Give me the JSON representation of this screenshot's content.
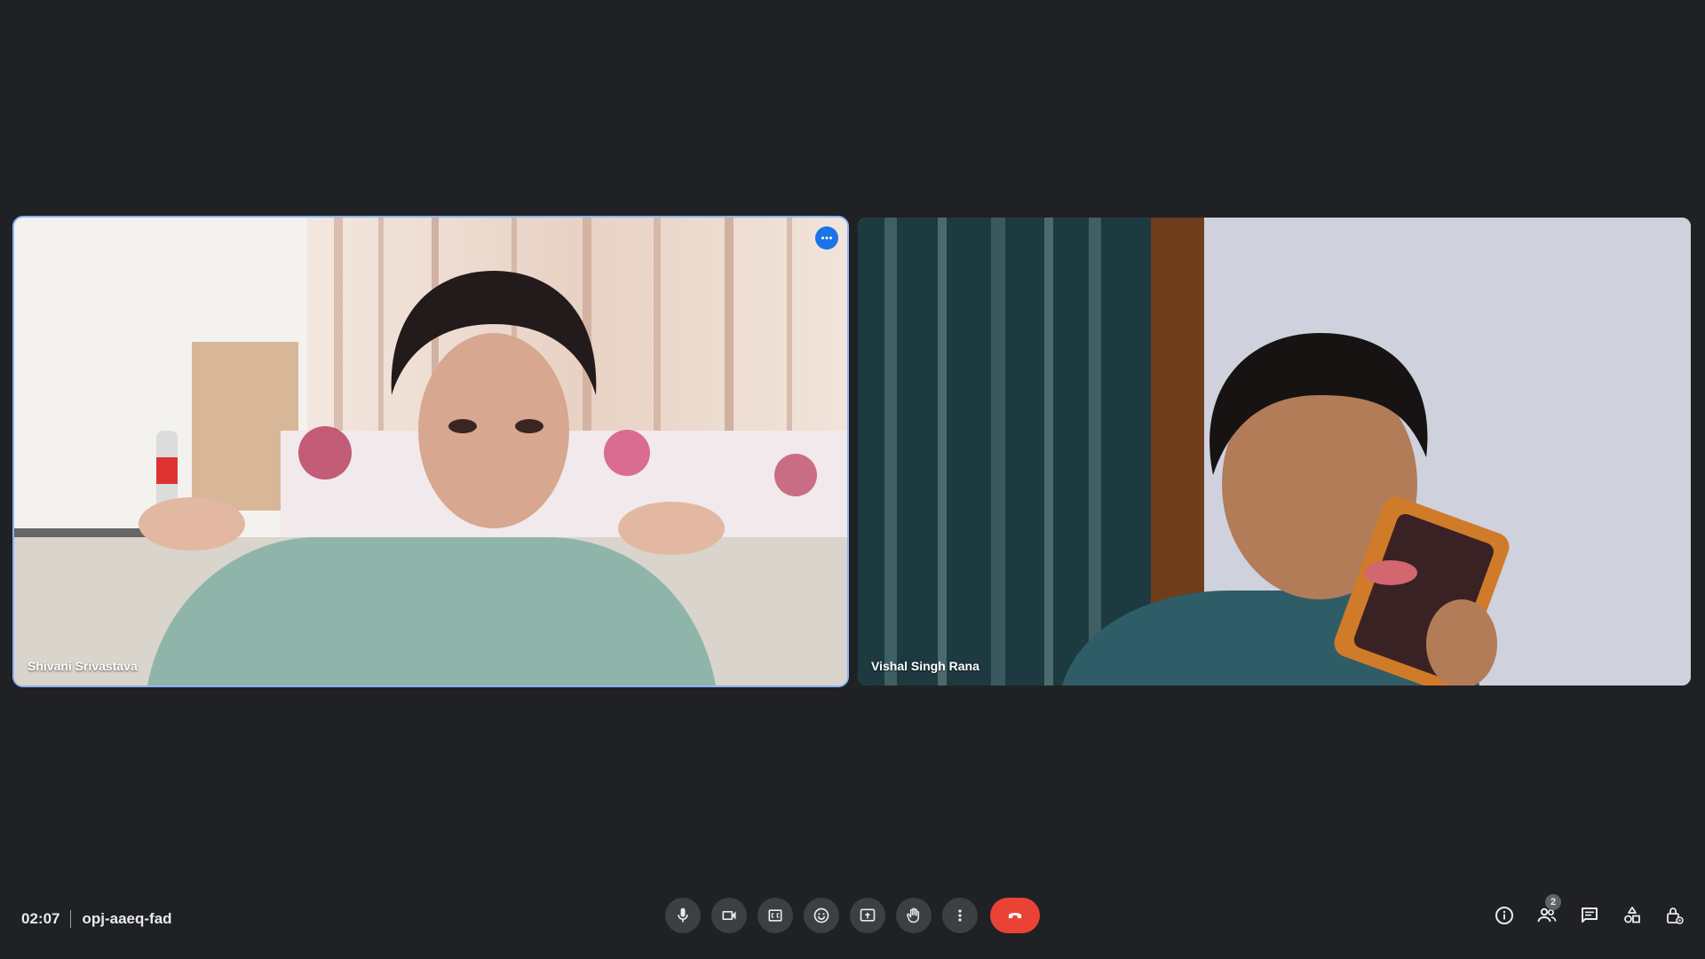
{
  "meeting": {
    "time": "02:07",
    "code": "opj-aaeq-fad"
  },
  "participants": [
    {
      "name": "Shivani Srivastava",
      "speaking": true
    },
    {
      "name": "Vishal Singh Rana",
      "speaking": false
    }
  ],
  "controls": [
    {
      "id": "microphone",
      "icon": "microphone-icon"
    },
    {
      "id": "camera",
      "icon": "video-camera-icon"
    },
    {
      "id": "captions",
      "icon": "closed-captions-icon"
    },
    {
      "id": "reactions",
      "icon": "emoji-icon"
    },
    {
      "id": "present",
      "icon": "present-screen-icon"
    },
    {
      "id": "raise-hand",
      "icon": "hand-icon"
    },
    {
      "id": "more-options",
      "icon": "more-vert-icon"
    },
    {
      "id": "leave-call",
      "icon": "hangup-icon"
    }
  ],
  "side_controls": {
    "people_count": "2",
    "icons": [
      "info-icon",
      "people-icon",
      "chat-icon",
      "activities-icon",
      "host-controls-icon"
    ]
  },
  "colors": {
    "background": "#202124",
    "control": "#3c4043",
    "hangup": "#ea4335",
    "active_outline": "#8ab4f8",
    "more_button": "#1a73e8"
  }
}
